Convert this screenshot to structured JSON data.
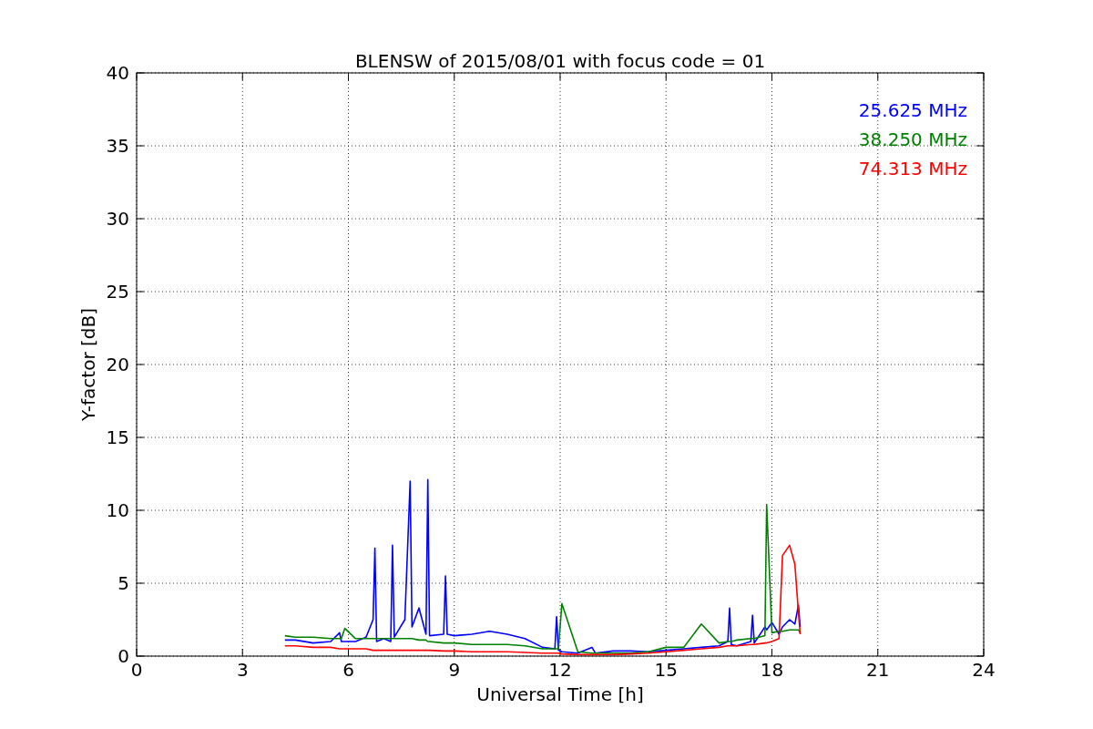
{
  "figure": {
    "chart_data": {
      "type": "line",
      "title": "BLENSW of 2015/08/01 with focus code = 01",
      "xlabel": "Universal Time [h]",
      "ylabel": "Y-factor [dB]",
      "xlim": [
        0,
        24
      ],
      "ylim": [
        0,
        40
      ],
      "xticks": [
        0,
        3,
        6,
        9,
        12,
        15,
        18,
        21,
        24
      ],
      "yticks": [
        0,
        5,
        10,
        15,
        20,
        25,
        30,
        35,
        40
      ],
      "grid": true,
      "x": [
        4.2,
        4.5,
        5.0,
        5.5,
        5.75,
        5.8,
        5.9,
        6.2,
        6.5,
        6.7,
        6.75,
        6.8,
        7.0,
        7.2,
        7.25,
        7.3,
        7.6,
        7.75,
        7.8,
        8.0,
        8.2,
        8.25,
        8.3,
        8.7,
        8.75,
        8.8,
        9.0,
        9.5,
        10.0,
        10.5,
        11.0,
        11.5,
        11.85,
        11.9,
        11.95,
        12.05,
        12.5,
        12.9,
        13.0,
        13.5,
        14.0,
        14.5,
        15.0,
        15.5,
        16.0,
        16.5,
        16.75,
        16.8,
        16.85,
        17.0,
        17.4,
        17.45,
        17.5,
        17.8,
        17.85,
        18.0,
        18.2,
        18.3,
        18.5,
        18.65,
        18.75,
        18.8
      ],
      "series": [
        {
          "name": "25.625 MHz",
          "color": "#0000ff",
          "values": [
            1.1,
            1.1,
            0.9,
            1.0,
            1.6,
            1.0,
            1.0,
            1.0,
            1.3,
            2.5,
            7.4,
            1.0,
            1.2,
            1.0,
            7.6,
            1.3,
            2.5,
            12.0,
            2.0,
            3.3,
            1.5,
            12.1,
            1.4,
            1.5,
            5.5,
            1.5,
            1.4,
            1.5,
            1.7,
            1.5,
            1.2,
            0.6,
            0.5,
            2.7,
            0.4,
            0.3,
            0.2,
            0.6,
            0.2,
            0.35,
            0.35,
            0.3,
            0.4,
            0.5,
            0.6,
            0.7,
            1.0,
            3.3,
            0.8,
            0.7,
            1.0,
            2.8,
            0.9,
            2.0,
            1.8,
            2.3,
            1.5,
            2.0,
            2.5,
            2.2,
            3.5,
            2.0
          ]
        },
        {
          "name": "38.250 MHz",
          "color": "#008000",
          "values": [
            1.4,
            1.3,
            1.3,
            1.2,
            1.2,
            1.2,
            1.9,
            1.2,
            1.2,
            1.2,
            1.2,
            1.2,
            1.2,
            1.2,
            1.2,
            1.2,
            1.2,
            1.2,
            1.2,
            1.1,
            1.1,
            1.0,
            1.0,
            0.9,
            0.9,
            0.9,
            0.9,
            0.8,
            0.8,
            0.8,
            0.7,
            0.5,
            0.5,
            0.5,
            0.5,
            3.6,
            0.3,
            0.2,
            0.2,
            0.2,
            0.2,
            0.3,
            0.6,
            0.6,
            2.2,
            0.9,
            1.0,
            1.0,
            1.0,
            1.1,
            1.2,
            1.2,
            1.2,
            1.4,
            10.4,
            1.6,
            1.7,
            1.7,
            1.8,
            1.8,
            1.8,
            1.6
          ]
        },
        {
          "name": "74.313 MHz",
          "color": "#ff0000",
          "values": [
            0.7,
            0.7,
            0.6,
            0.6,
            0.5,
            0.5,
            0.5,
            0.5,
            0.5,
            0.4,
            0.4,
            0.4,
            0.4,
            0.4,
            0.4,
            0.4,
            0.4,
            0.4,
            0.4,
            0.4,
            0.4,
            0.4,
            0.4,
            0.35,
            0.35,
            0.35,
            0.35,
            0.3,
            0.3,
            0.3,
            0.25,
            0.2,
            0.2,
            0.2,
            0.2,
            0.15,
            0.1,
            0.1,
            0.1,
            0.1,
            0.15,
            0.2,
            0.3,
            0.4,
            0.5,
            0.6,
            0.7,
            0.7,
            0.7,
            0.7,
            0.8,
            0.8,
            0.8,
            0.9,
            0.9,
            1.0,
            1.2,
            6.9,
            7.6,
            6.3,
            3.0,
            1.5
          ]
        }
      ]
    }
  }
}
